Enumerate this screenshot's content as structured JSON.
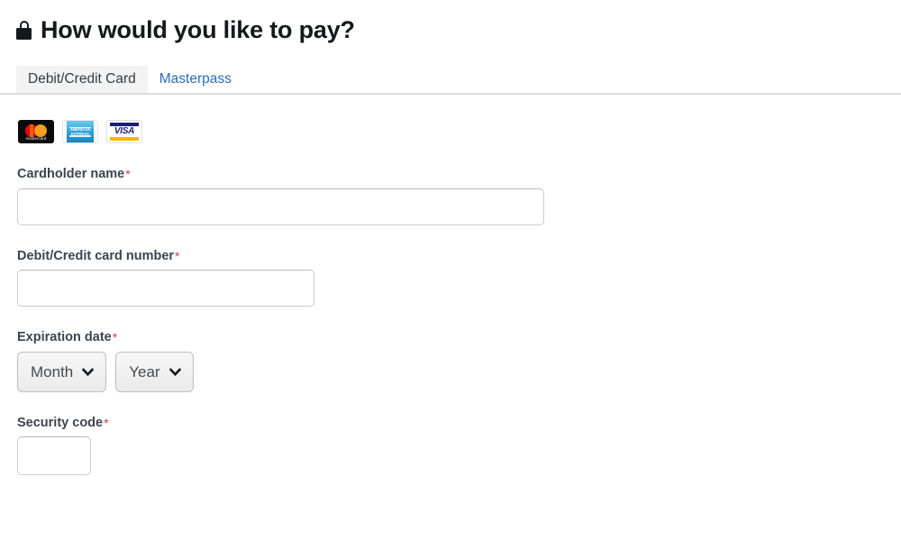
{
  "header": {
    "lock_icon": "lock-icon",
    "title": "How would you like to pay?"
  },
  "tabs": [
    {
      "label": "Debit/Credit Card",
      "active": true
    },
    {
      "label": "Masterpass",
      "active": false
    }
  ],
  "card_brands": [
    {
      "name": "mastercard",
      "text": "mastercard"
    },
    {
      "name": "american-express",
      "line1": "AMERICAN",
      "line2": "EXPRESS"
    },
    {
      "name": "visa",
      "text": "VISA"
    }
  ],
  "form": {
    "cardholder": {
      "label": "Cardholder name",
      "required_mark": "*",
      "value": "",
      "placeholder": ""
    },
    "card_number": {
      "label": "Debit/Credit card number",
      "required_mark": "*",
      "value": "",
      "placeholder": ""
    },
    "expiration": {
      "label": "Expiration date",
      "required_mark": "*",
      "month_value": "Month",
      "year_value": "Year"
    },
    "security_code": {
      "label": "Security code",
      "required_mark": "*",
      "value": "",
      "placeholder": ""
    }
  },
  "colors": {
    "link_blue": "#2b6cb8",
    "required_red": "#c9444a",
    "label_gray": "#3b454f",
    "tab_active_bg": "#f3f3f3",
    "border_gray": "#dcdcdc"
  }
}
